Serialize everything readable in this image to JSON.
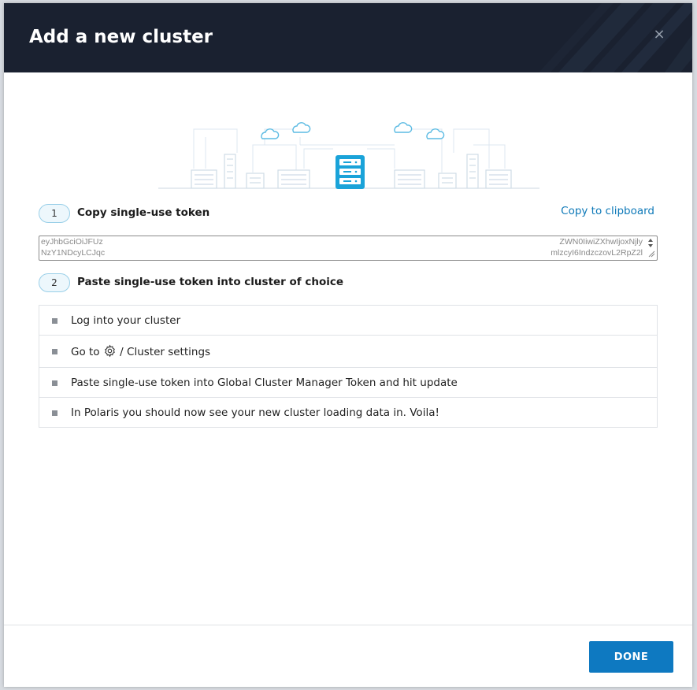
{
  "dialog": {
    "title": "Add a new cluster",
    "close_glyph": "×"
  },
  "step1": {
    "number": "1",
    "label": "Copy single-use token",
    "copy_link": "Copy to clipboard"
  },
  "token": {
    "line1_left": "eyJhbGciOiJFUz",
    "line1_right": "ZWN0IiwiZXhwIjoxNjly",
    "line2_left": "NzY1NDcyLCJqc",
    "line2_right": "mlzcyI6IndzczovL2RpZ2l"
  },
  "step2": {
    "number": "2",
    "label": "Paste single-use token into cluster of choice"
  },
  "instructions": [
    {
      "text": "Log into your cluster"
    },
    {
      "text_before": "Go to",
      "icon": "gear-icon",
      "text_after": "/ Cluster settings"
    },
    {
      "text": "Paste single-use token into Global Cluster Manager Token and hit update"
    },
    {
      "text": "In Polaris you should now see your new cluster loading data in. Voila!"
    }
  ],
  "footer": {
    "done_label": "DONE"
  },
  "colors": {
    "header_bg": "#1a2130",
    "accent": "#0e79c1",
    "link": "#0e79b8",
    "illustration_line": "#dde7f0",
    "illustration_accent": "#1aa3d9"
  }
}
